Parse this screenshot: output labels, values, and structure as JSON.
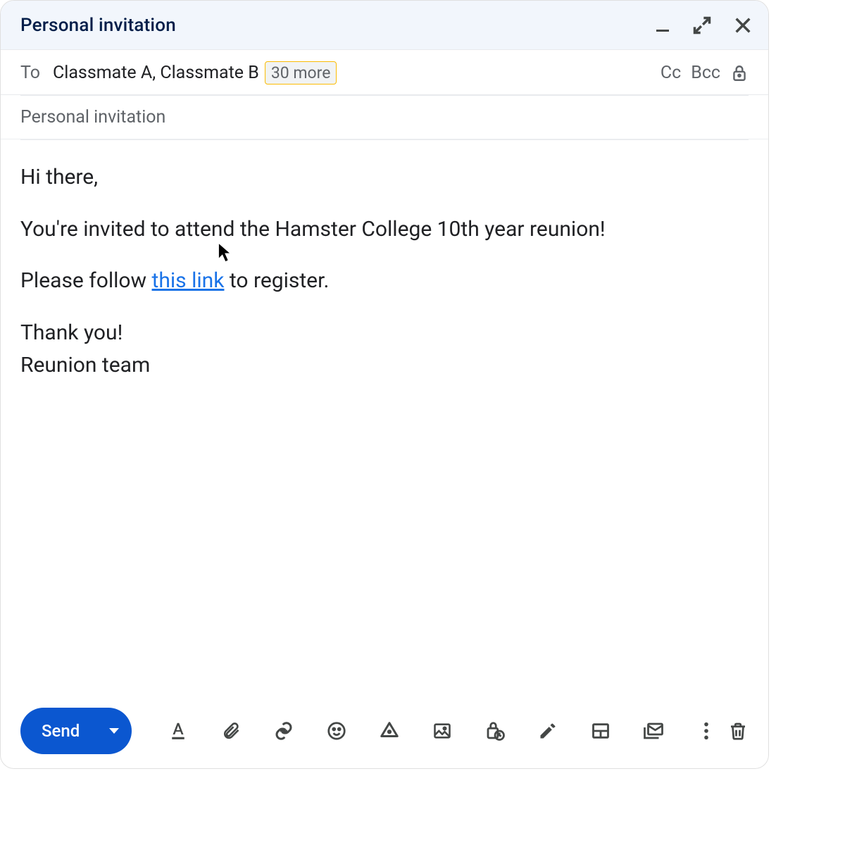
{
  "window": {
    "title": "Personal invitation"
  },
  "recipients": {
    "to_label": "To",
    "names": "Classmate A, Classmate B",
    "more_chip": "30 more",
    "cc_label": "Cc",
    "bcc_label": "Bcc"
  },
  "subject": {
    "value": "Personal invitation"
  },
  "body": {
    "greeting": "Hi there,",
    "line1": "You're invited to attend the Hamster College 10th year reunion!",
    "line2_pre": "Please follow ",
    "link_text": "this link",
    "line2_post": " to register.",
    "thank": "Thank you!",
    "signoff": "Reunion team"
  },
  "toolbar": {
    "send_label": "Send"
  },
  "icons": {
    "minimize": "minimize-icon",
    "fullscreen": "fullscreen-icon",
    "close": "close-icon",
    "lock": "lock-icon",
    "format": "text-format-icon",
    "attach": "paperclip-icon",
    "link": "link-icon",
    "emoji": "emoji-icon",
    "drive": "drive-icon",
    "image": "image-icon",
    "confidential": "confidential-icon",
    "pen": "pen-icon",
    "layout": "layout-icon",
    "mail": "mail-icon",
    "more": "more-options-icon",
    "trash": "trash-icon"
  }
}
